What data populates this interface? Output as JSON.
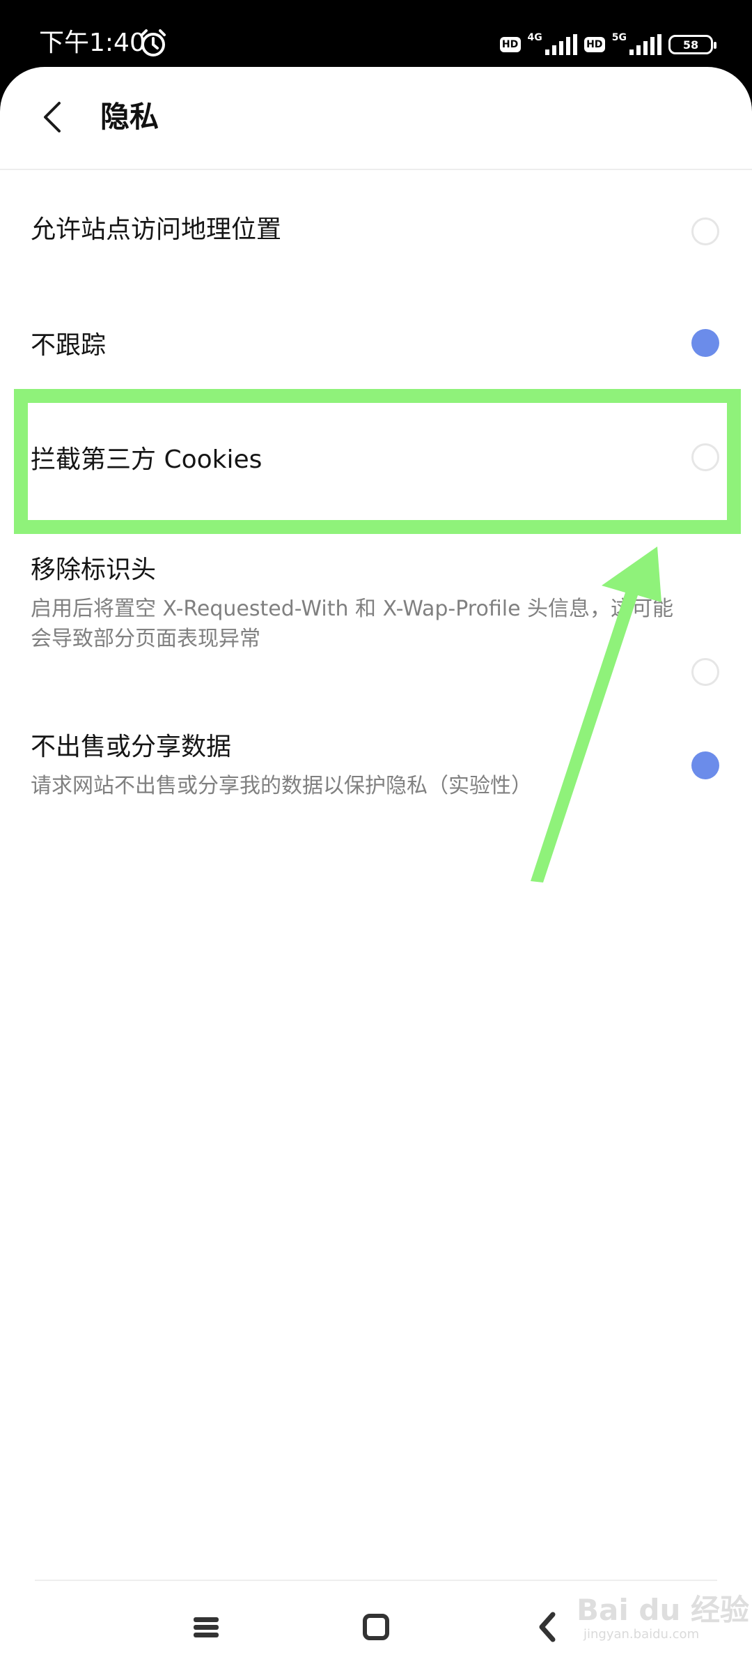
{
  "status_bar": {
    "time": "下午1:40",
    "hd1": "HD",
    "net1": "4G",
    "hd2": "HD",
    "net2": "5G",
    "battery": "58"
  },
  "header": {
    "title": "隐私"
  },
  "settings": [
    {
      "title": "允许站点访问地理位置",
      "description": "",
      "enabled": false
    },
    {
      "title": "不跟踪",
      "description": "",
      "enabled": true
    },
    {
      "title": "拦截第三方 Cookies",
      "description": "",
      "enabled": false
    },
    {
      "title": "移除标识头",
      "description": "启用后将置空 X-Requested-With 和 X-Wap-Profile 头信息，这可能会导致部分页面表现异常",
      "enabled": false
    },
    {
      "title": "不出售或分享数据",
      "description": "请求网站不出售或分享我的数据以保护隐私（实验性）",
      "enabled": true
    }
  ],
  "watermark": {
    "text": "Bai du 经验",
    "sub": "jingyan.baidu.com"
  },
  "colors": {
    "accent": "#6b8cea",
    "annotation": "#8ff27a"
  },
  "icons": {
    "back": "chevron-left-icon",
    "alarm": "alarm-clock-icon",
    "menu": "menu-icon",
    "home": "square-icon",
    "nav_back": "chevron-left-icon"
  }
}
